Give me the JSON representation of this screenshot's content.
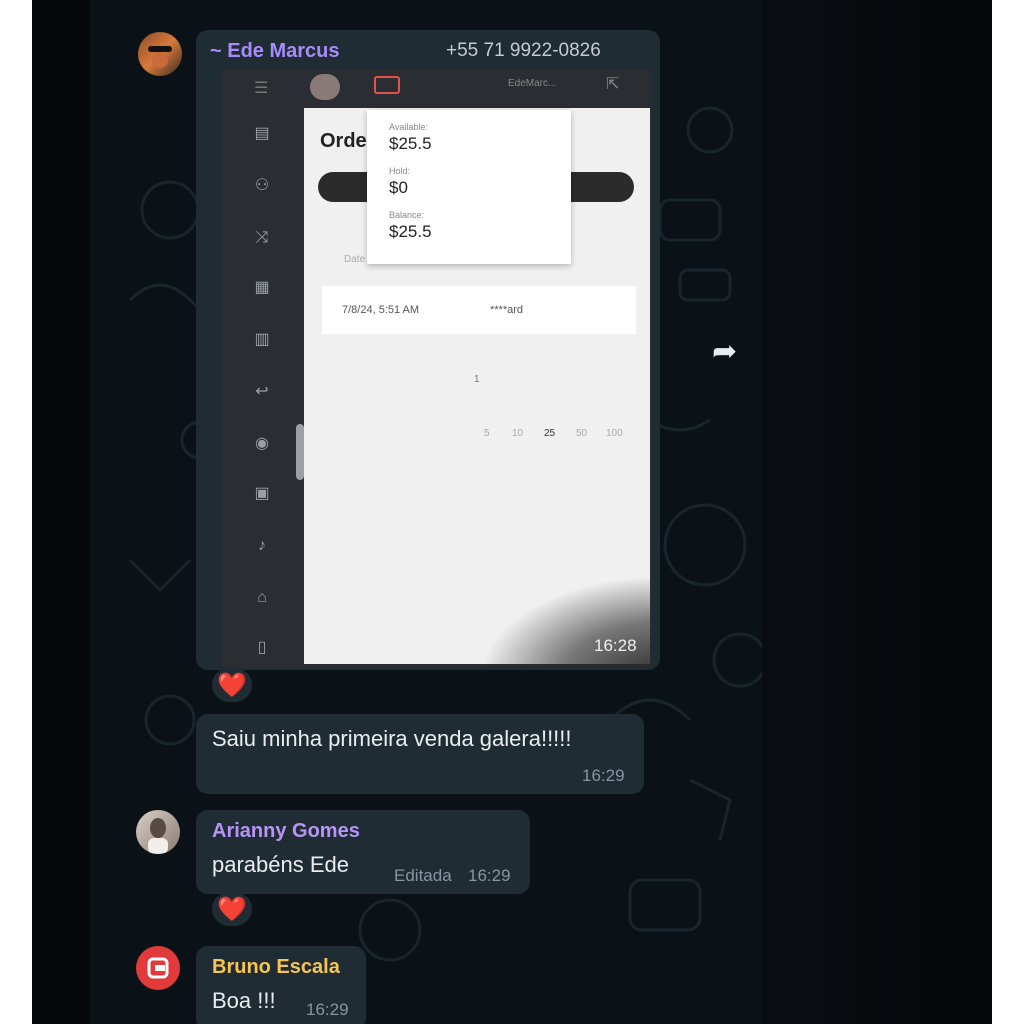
{
  "message1": {
    "sender": "~ Ede Marcus",
    "phone": "+55 71 9922-0826",
    "image_time": "16:28",
    "reaction": "❤️",
    "screenshot": {
      "header_user": "EdeMarc...",
      "title": "Orde",
      "popup": {
        "available_label": "Available:",
        "available_value": "$25.5",
        "hold_label": "Hold:",
        "hold_value": "$0",
        "balance_label": "Balance:",
        "balance_value": "$25.5"
      },
      "column_label": "Date",
      "row_date": "7/8/24, 5:51 AM",
      "row_card": "****ard",
      "page_number": "1",
      "page_sizes": [
        "5",
        "10",
        "25",
        "50",
        "100"
      ]
    }
  },
  "message2": {
    "text": "Saiu minha primeira venda galera!!!!!",
    "time": "16:29"
  },
  "message3": {
    "sender": "Arianny Gomes",
    "text": "parabéns Ede",
    "edited": "Editada",
    "time": "16:29",
    "reaction": "❤️"
  },
  "message4": {
    "sender": "Bruno Escala",
    "text": "Boa !!!",
    "time": "16:29"
  },
  "colors": {
    "sender1": "#a78bfa",
    "sender2": "#b794f6",
    "sender3": "#f6c453",
    "bubble": "#1f2c34",
    "background": "#0b1217"
  }
}
